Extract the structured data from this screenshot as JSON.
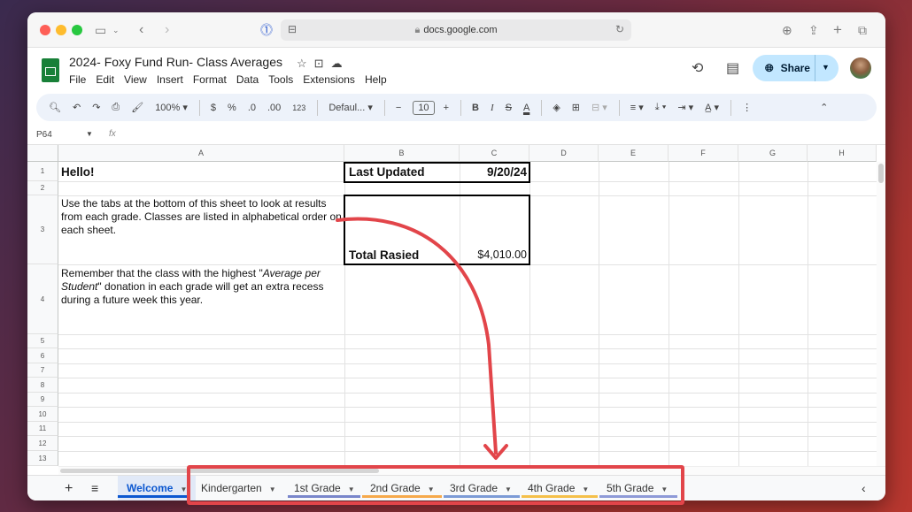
{
  "browser": {
    "url": "docs.google.com"
  },
  "doc": {
    "title": "2024- Foxy Fund Run- Class Averages",
    "menu": [
      "File",
      "Edit",
      "View",
      "Insert",
      "Format",
      "Data",
      "Tools",
      "Extensions",
      "Help"
    ],
    "share_label": "Share"
  },
  "toolbar": {
    "zoom": "100%",
    "currency": "$",
    "percent": "%",
    "dec_decrease": ".0",
    "dec_increase": ".00",
    "number_format": "123",
    "font": "Defaul...",
    "font_size": "10",
    "bold": "B",
    "italic": "I",
    "strike": "S",
    "text_color": "A"
  },
  "formula_bar": {
    "name_box": "P64",
    "fx": "fx"
  },
  "grid": {
    "columns": [
      "A",
      "B",
      "C",
      "D",
      "E",
      "F",
      "G",
      "H"
    ],
    "rows": [
      "1",
      "2",
      "3",
      "4",
      "5",
      "6",
      "7",
      "8",
      "9",
      "10",
      "11",
      "12",
      "13"
    ],
    "cells": {
      "a1": "Hello!",
      "b1": "Last Updated",
      "c1": "9/20/24",
      "a3": "Use the tabs at the bottom of this sheet to look at results from each grade. Classes are listed in alphabetical order on each sheet.",
      "b3": "Total Rasied",
      "c3": "$4,010.00",
      "a4_pre": "Remember that the class with the highest \"",
      "a4_em": "Average per Student",
      "a4_post": "\" donation in each grade will get an extra recess during a future week this year."
    }
  },
  "tabs": [
    {
      "label": "Welcome",
      "color": "#0b57d0"
    },
    {
      "label": "Kindergarten",
      "color": "#9aa0a6"
    },
    {
      "label": "1st Grade",
      "color": "#7986cb"
    },
    {
      "label": "2nd Grade",
      "color": "#f6a94b"
    },
    {
      "label": "3rd Grade",
      "color": "#7c9bd6"
    },
    {
      "label": "4th Grade",
      "color": "#f5c04a"
    },
    {
      "label": "5th Grade",
      "color": "#8e9ad8"
    }
  ],
  "annotation_color": "#e2454a"
}
